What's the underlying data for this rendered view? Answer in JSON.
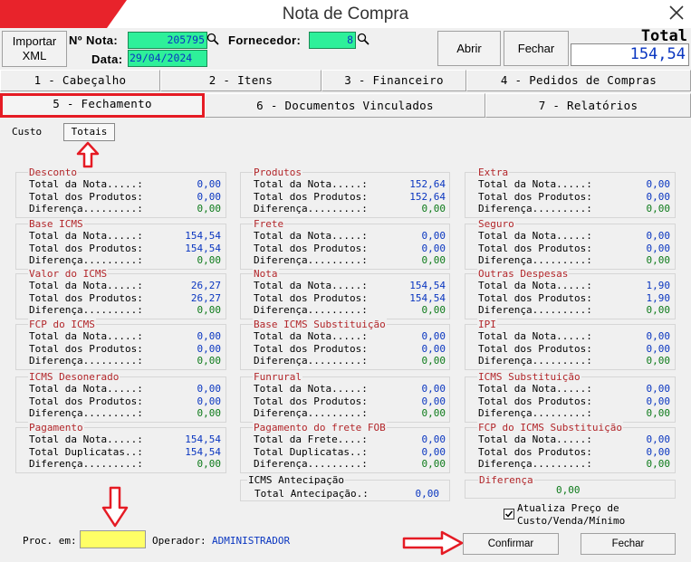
{
  "window": {
    "title": "Nota de Compra"
  },
  "header": {
    "importar_label": "Importar XML",
    "nota_label": "Nº Nota:",
    "nota_value": "205795",
    "fornecedor_label": "Fornecedor:",
    "fornecedor_value": "8",
    "data_label": "Data:",
    "data_value": "29/04/2024",
    "abrir_label": "Abrir",
    "fechar_label": "Fechar",
    "total_label": "Total",
    "total_value": "154,54"
  },
  "tabs": [
    {
      "label": "1 - Cabeçalho"
    },
    {
      "label": "2 - Itens"
    },
    {
      "label": "3 - Financeiro"
    },
    {
      "label": "4 - Pedidos de Compras"
    },
    {
      "label": "5 - Fechamento"
    },
    {
      "label": "6 - Documentos Vinculados"
    },
    {
      "label": "7 - Relatórios"
    }
  ],
  "subtabs": [
    {
      "label": "Custo"
    },
    {
      "label": "Totais"
    }
  ],
  "groups": [
    {
      "title": "Desconto",
      "rows": [
        {
          "k": "Total da Nota.....:",
          "v": "0,00"
        },
        {
          "k": "Total dos Produtos:",
          "v": "0,00"
        },
        {
          "k": "Diferença.........:",
          "v": "0,00"
        }
      ]
    },
    {
      "title": "Produtos",
      "rows": [
        {
          "k": "Total da Nota.....:",
          "v": "152,64"
        },
        {
          "k": "Total dos Produtos:",
          "v": "152,64"
        },
        {
          "k": "Diferença.........:",
          "v": "0,00"
        }
      ]
    },
    {
      "title": "Extra",
      "rows": [
        {
          "k": "Total da Nota.....:",
          "v": "0,00"
        },
        {
          "k": "Total dos Produtos:",
          "v": "0,00"
        },
        {
          "k": "Diferença.........:",
          "v": "0,00"
        }
      ]
    },
    {
      "title": "Base ICMS",
      "rows": [
        {
          "k": "Total da Nota.....:",
          "v": "154,54"
        },
        {
          "k": "Total dos Produtos:",
          "v": "154,54"
        },
        {
          "k": "Diferença.........:",
          "v": "0,00"
        }
      ]
    },
    {
      "title": "Frete",
      "rows": [
        {
          "k": "Total da Nota.....:",
          "v": "0,00"
        },
        {
          "k": "Total dos Produtos:",
          "v": "0,00"
        },
        {
          "k": "Diferença.........:",
          "v": "0,00"
        }
      ]
    },
    {
      "title": "Seguro",
      "rows": [
        {
          "k": "Total da Nota.....:",
          "v": "0,00"
        },
        {
          "k": "Total dos Produtos:",
          "v": "0,00"
        },
        {
          "k": "Diferença.........:",
          "v": "0,00"
        }
      ]
    },
    {
      "title": "Valor do ICMS",
      "rows": [
        {
          "k": "Total da Nota.....:",
          "v": "26,27"
        },
        {
          "k": "Total dos Produtos:",
          "v": "26,27"
        },
        {
          "k": "Diferença.........:",
          "v": "0,00"
        }
      ]
    },
    {
      "title": "Nota",
      "rows": [
        {
          "k": "Total da Nota.....:",
          "v": "154,54"
        },
        {
          "k": "Total dos Produtos:",
          "v": "154,54"
        },
        {
          "k": "Diferença.........:",
          "v": "0,00"
        }
      ]
    },
    {
      "title": "Outras Despesas",
      "rows": [
        {
          "k": "Total da Nota.....:",
          "v": "1,90"
        },
        {
          "k": "Total dos Produtos:",
          "v": "1,90"
        },
        {
          "k": "Diferença.........:",
          "v": "0,00"
        }
      ]
    },
    {
      "title": "FCP do ICMS",
      "rows": [
        {
          "k": "Total da Nota.....:",
          "v": "0,00"
        },
        {
          "k": "Total dos Produtos:",
          "v": "0,00"
        },
        {
          "k": "Diferença.........:",
          "v": "0,00"
        }
      ]
    },
    {
      "title": "Base ICMS Substituição",
      "rows": [
        {
          "k": "Total da Nota.....:",
          "v": "0,00"
        },
        {
          "k": "Total dos Produtos:",
          "v": "0,00"
        },
        {
          "k": "Diferença.........:",
          "v": "0,00"
        }
      ]
    },
    {
      "title": "IPI",
      "rows": [
        {
          "k": "Total da Nota.....:",
          "v": "0,00"
        },
        {
          "k": "Total dos Produtos:",
          "v": "0,00"
        },
        {
          "k": "Diferença.........:",
          "v": "0,00"
        }
      ]
    },
    {
      "title": "ICMS Desonerado",
      "rows": [
        {
          "k": "Total da Nota.....:",
          "v": "0,00"
        },
        {
          "k": "Total dos Produtos:",
          "v": "0,00"
        },
        {
          "k": "Diferença.........:",
          "v": "0,00"
        }
      ]
    },
    {
      "title": "Funrural",
      "rows": [
        {
          "k": "Total da Nota.....:",
          "v": "0,00"
        },
        {
          "k": "Total dos Produtos:",
          "v": "0,00"
        },
        {
          "k": "Diferença.........:",
          "v": "0,00"
        }
      ]
    },
    {
      "title": "ICMS Substituição",
      "rows": [
        {
          "k": "Total da Nota.....:",
          "v": "0,00"
        },
        {
          "k": "Total dos Produtos:",
          "v": "0,00"
        },
        {
          "k": "Diferença.........:",
          "v": "0,00"
        }
      ]
    },
    {
      "title": "Pagamento",
      "rows": [
        {
          "k": "Total da Nota.....:",
          "v": "154,54"
        },
        {
          "k": "Total Duplicatas..:",
          "v": "154,54"
        },
        {
          "k": "Diferença.........:",
          "v": "0,00"
        }
      ]
    },
    {
      "title": "Pagamento do frete FOB",
      "rows": [
        {
          "k": "Total da Frete....:",
          "v": "0,00"
        },
        {
          "k": "Total Duplicatas..:",
          "v": "0,00"
        },
        {
          "k": "Diferença.........:",
          "v": "0,00"
        }
      ]
    },
    {
      "title": "FCP do ICMS Substituição",
      "rows": [
        {
          "k": "Total da Nota.....:",
          "v": "0,00"
        },
        {
          "k": "Total dos Produtos:",
          "v": "0,00"
        },
        {
          "k": "Diferença.........:",
          "v": "0,00"
        }
      ]
    }
  ],
  "antecipacao": {
    "title": "ICMS Antecipação",
    "label": "Total Antecipação.:",
    "value": "0,00"
  },
  "diferenca": {
    "title": "Diferença",
    "value": "0,00"
  },
  "bottom": {
    "proc_label": "Proc. em:",
    "operador_label": "Operador:",
    "operador_value": "ADMINISTRADOR",
    "atualiza_label_1": "Atualiza Preço de",
    "atualiza_label_2": "Custo/Venda/Mínimo",
    "confirmar_label": "Confirmar",
    "fechar_label": "Fechar"
  },
  "colors": {
    "accent": "#e51b24",
    "field_green": "#2ef09a",
    "value_blue": "#0a36c0",
    "diff_green": "#0d7a1a",
    "group_title": "#b2262a"
  },
  "icons": [
    "close-icon",
    "magnifier-icon",
    "red-arrow-icon",
    "checkbox-icon"
  ]
}
